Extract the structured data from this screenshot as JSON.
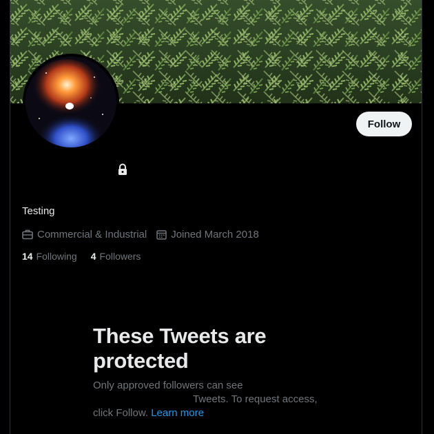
{
  "profile": {
    "display_name": "Testing",
    "category": "Commercial & Industrial",
    "joined": "Joined March 2018",
    "following_count": "14",
    "following_label": "Following",
    "followers_count": "4",
    "followers_label": "Followers"
  },
  "actions": {
    "follow_label": "Follow"
  },
  "protected": {
    "title": "These Tweets are protected",
    "body_line1": "Only approved followers can see",
    "body_line2": "Tweets. To request access,",
    "body_line3": "click Follow.",
    "learn_more": "Learn more"
  },
  "icons": {
    "lock": "lock-icon",
    "category": "briefcase-icon",
    "joined": "calendar-icon"
  },
  "colors": {
    "background": "#000000",
    "text_primary": "#e7e9ea",
    "text_secondary": "#71767b",
    "link": "#1d9bf0",
    "button_bg": "#eff3f4",
    "button_text": "#0f1419"
  }
}
